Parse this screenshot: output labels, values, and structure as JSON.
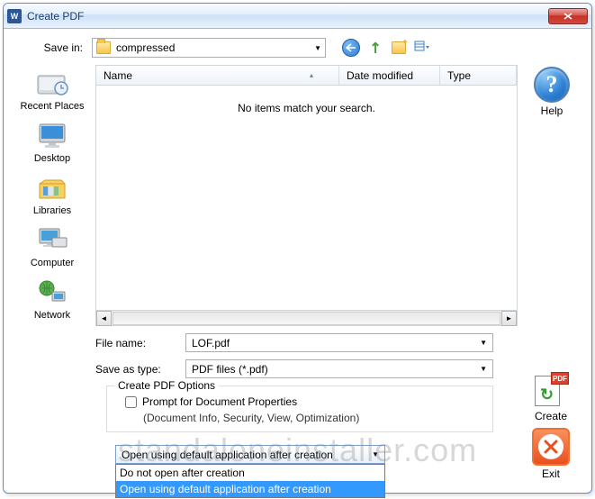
{
  "window": {
    "title": "Create PDF"
  },
  "savein": {
    "label": "Save in:",
    "folder": "compressed"
  },
  "places": {
    "recent": "Recent Places",
    "desktop": "Desktop",
    "libraries": "Libraries",
    "computer": "Computer",
    "network": "Network"
  },
  "filelist": {
    "col_name": "Name",
    "col_date": "Date modified",
    "col_type": "Type",
    "empty": "No items match your search."
  },
  "help_label": "Help",
  "filename": {
    "label": "File name:",
    "value": "LOF.pdf"
  },
  "savetype": {
    "label": "Save as type:",
    "value": "PDF files (*.pdf)"
  },
  "options": {
    "legend": "Create PDF Options",
    "prompt": "Prompt for Document Properties",
    "prompt_sub": "(Document Info, Security, View, Optimization)"
  },
  "after": {
    "selected": "Open using default application after creation",
    "opt0": "Do not open after creation",
    "opt1": "Open using default application after creation"
  },
  "actions": {
    "create": "Create",
    "exit": "Exit",
    "pdf_badge": "PDF"
  },
  "watermark": "standaloneinstaller.com"
}
